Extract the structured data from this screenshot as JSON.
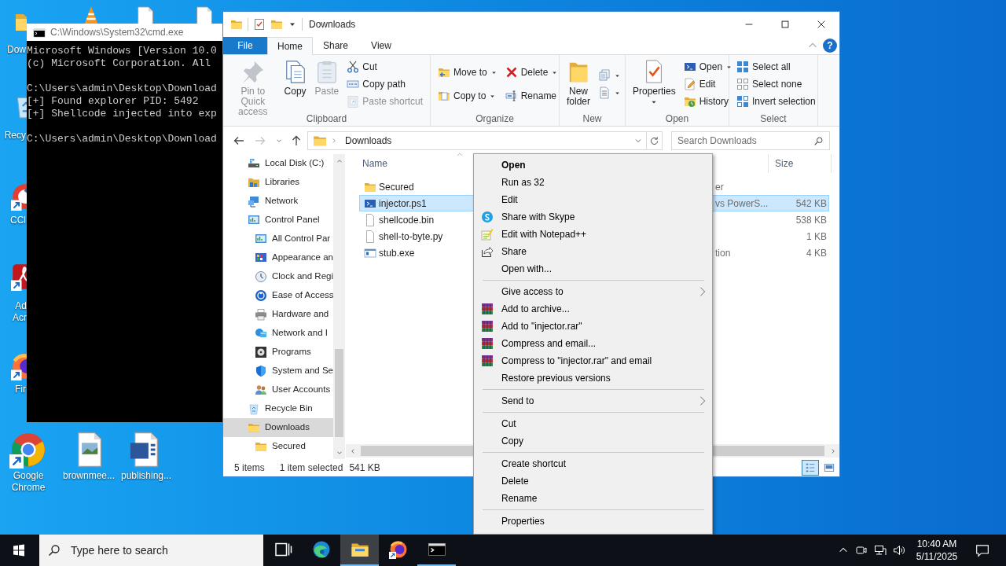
{
  "desktop": {
    "icons": [
      {
        "kind": "folder",
        "label": "Dow"
      },
      {
        "kind": "cone"
      },
      {
        "kind": "document"
      },
      {
        "kind": "document"
      },
      {
        "kind": "recycle",
        "label": "Recy"
      },
      {
        "kind": "cleaner",
        "label": "CCl"
      },
      {
        "kind": "reader",
        "label": "Ad Acr"
      },
      {
        "kind": "firefox",
        "label": "Fir"
      },
      {
        "kind": "chrome",
        "label": "Google Chrome"
      },
      {
        "kind": "image",
        "label": "brownmee..."
      },
      {
        "kind": "word",
        "label": "publishing..."
      }
    ]
  },
  "console": {
    "title": "C:\\Windows\\System32\\cmd.exe",
    "blocks": [
      [
        "Microsoft Windows [Version 10.0",
        "(c) Microsoft Corporation. All"
      ],
      [
        "C:\\Users\\admin\\Desktop\\Download",
        "[+] Found explorer PID: 5492",
        "[+] Shellcode injected into exp"
      ],
      [
        "C:\\Users\\admin\\Desktop\\Download"
      ]
    ]
  },
  "explorer": {
    "title": "Downloads",
    "tabs": [
      {
        "label": "File",
        "kind": "file",
        "selected": false
      },
      {
        "label": "Home",
        "kind": "tab",
        "selected": true
      },
      {
        "label": "Share",
        "kind": "tab",
        "selected": false
      },
      {
        "label": "View",
        "kind": "tab",
        "selected": false
      }
    ],
    "help": "?",
    "ribbon": {
      "groups": [
        {
          "label": "Clipboard",
          "large": [
            {
              "kind": "pin",
              "label": "Pin to Quick access",
              "disabled": true,
              "dropdown": false
            },
            {
              "kind": "copy",
              "label": "Copy",
              "disabled": false,
              "dropdown": false
            },
            {
              "kind": "paste",
              "label": "Paste",
              "disabled": true,
              "dropdown": false
            }
          ],
          "small_columns": [
            [
              {
                "kind": "cut",
                "label": "Cut",
                "disabled": false,
                "dropdown": false
              },
              {
                "kind": "copy-path",
                "label": "Copy path",
                "disabled": false,
                "dropdown": false
              },
              {
                "kind": "paste-shortcut",
                "label": "Paste shortcut",
                "disabled": true,
                "dropdown": false
              }
            ]
          ]
        },
        {
          "label": "Organize",
          "small_columns": [
            [
              {
                "kind": "move-to",
                "label": "Move to",
                "disabled": false,
                "dropdown": true
              },
              {
                "kind": "copy-to",
                "label": "Copy to",
                "disabled": false,
                "dropdown": true
              }
            ],
            [
              {
                "kind": "delete",
                "label": "Delete",
                "disabled": false,
                "dropdown": true
              },
              {
                "kind": "rename",
                "label": "Rename",
                "disabled": false,
                "dropdown": false
              }
            ]
          ]
        },
        {
          "label": "New",
          "large": [
            {
              "kind": "new-folder",
              "label": "New folder",
              "disabled": false,
              "dropdown": false
            }
          ],
          "small_columns": [
            [
              {
                "kind": "new-item",
                "disabled": false,
                "dropdown": true
              },
              {
                "kind": "easy-access",
                "disabled": false,
                "dropdown": true
              }
            ]
          ]
        },
        {
          "label": "Open",
          "large": [
            {
              "kind": "properties",
              "label": "Properties",
              "disabled": false,
              "dropdown": true
            }
          ],
          "small_columns": [
            [
              {
                "kind": "open",
                "label": "Open",
                "disabled": false,
                "dropdown": true
              },
              {
                "kind": "edit",
                "label": "Edit",
                "disabled": false,
                "dropdown": false
              },
              {
                "kind": "history",
                "label": "History",
                "disabled": false,
                "dropdown": false
              }
            ]
          ]
        },
        {
          "label": "Select",
          "small_columns": [
            [
              {
                "kind": "select-all",
                "label": "Select all",
                "disabled": false,
                "dropdown": false
              },
              {
                "kind": "select-none",
                "label": "Select none",
                "disabled": false,
                "dropdown": false
              },
              {
                "kind": "invert",
                "label": "Invert selection",
                "disabled": false,
                "dropdown": false
              }
            ]
          ]
        }
      ]
    },
    "nav_buttons": [
      {
        "kind": "back",
        "disabled": false
      },
      {
        "kind": "forward",
        "disabled": true
      },
      {
        "kind": "recent",
        "disabled": false
      },
      {
        "kind": "up",
        "disabled": false
      }
    ],
    "address": "Downloads",
    "search_placeholder": "Search Downloads",
    "nav": [
      {
        "kind": "drive",
        "label": "Local Disk (C:)",
        "selected": false
      },
      {
        "kind": "library",
        "label": "Libraries",
        "selected": false
      },
      {
        "kind": "network",
        "label": "Network",
        "selected": false
      },
      {
        "kind": "control-panel",
        "label": "Control Panel",
        "selected": false,
        "children": [
          {
            "kind": "control-panel",
            "label": "All Control Par",
            "selected": false
          },
          {
            "kind": "appearance",
            "label": "Appearance an",
            "selected": false
          },
          {
            "kind": "clock",
            "label": "Clock and Regi",
            "selected": false
          },
          {
            "kind": "ease",
            "label": "Ease of Access",
            "selected": false
          },
          {
            "kind": "hardware",
            "label": "Hardware and",
            "selected": false
          },
          {
            "kind": "network-internet",
            "label": "Network and I",
            "selected": false
          },
          {
            "kind": "programs",
            "label": "Programs",
            "selected": false
          },
          {
            "kind": "system",
            "label": "System and Se",
            "selected": false
          },
          {
            "kind": "users",
            "label": "User Accounts",
            "selected": false
          }
        ]
      },
      {
        "kind": "recycle",
        "label": "Recycle Bin",
        "selected": false
      },
      {
        "kind": "folder",
        "label": "Downloads",
        "selected": true,
        "children": [
          {
            "kind": "folder",
            "label": "Secured",
            "selected": false
          }
        ]
      }
    ],
    "columns": {
      "name": "Name",
      "size": "Size"
    },
    "files": [
      {
        "kind": "folder",
        "name": "Secured",
        "column_3": "er",
        "selected": false
      },
      {
        "kind": "script",
        "name": "injector.ps1",
        "column_3": "vs PowerS...",
        "size": "542 KB",
        "selected": true
      },
      {
        "kind": "file",
        "name": "shellcode.bin",
        "size": "538 KB",
        "selected": false
      },
      {
        "kind": "file",
        "name": "shell-to-byte.py",
        "size": "1 KB",
        "selected": false
      },
      {
        "kind": "program",
        "name": "stub.exe",
        "column_3": "tion",
        "size": "4 KB",
        "selected": false
      }
    ],
    "status": {
      "count": "5 items",
      "selection": "1 item selected",
      "selection_size": "541 KB"
    },
    "views": [
      {
        "kind": "details",
        "selected": true
      },
      {
        "kind": "large-icons",
        "selected": false
      }
    ]
  },
  "context_menu": {
    "items": [
      {
        "kind": "plain",
        "label": "Open",
        "default": true
      },
      {
        "kind": "plain",
        "label": "Run as 32",
        "default": false
      },
      {
        "kind": "plain",
        "label": "Edit",
        "default": false
      },
      {
        "kind": "chat",
        "label": "Share with Skype",
        "default": false
      },
      {
        "kind": "notepad",
        "label": "Edit with Notepad++",
        "default": false
      },
      {
        "kind": "share",
        "label": "Share",
        "default": false
      },
      {
        "kind": "plain",
        "label": "Open with...",
        "default": false
      },
      {
        "kind": "separator"
      },
      {
        "kind": "submenu",
        "label": "Give access to",
        "default": false
      },
      {
        "kind": "archive",
        "label": "Add to archive...",
        "default": false
      },
      {
        "kind": "archive",
        "label": "Add to \"injector.rar\"",
        "default": false
      },
      {
        "kind": "archive",
        "label": "Compress and email...",
        "default": false
      },
      {
        "kind": "archive",
        "label": "Compress to \"injector.rar\" and email",
        "default": false
      },
      {
        "kind": "plain",
        "label": "Restore previous versions",
        "default": false
      },
      {
        "kind": "separator"
      },
      {
        "kind": "submenu",
        "label": "Send to",
        "default": false
      },
      {
        "kind": "separator"
      },
      {
        "kind": "plain",
        "label": "Cut",
        "default": false
      },
      {
        "kind": "plain",
        "label": "Copy",
        "default": false
      },
      {
        "kind": "separator"
      },
      {
        "kind": "plain",
        "label": "Create shortcut",
        "default": false
      },
      {
        "kind": "plain",
        "label": "Delete",
        "default": false
      },
      {
        "kind": "plain",
        "label": "Rename",
        "default": false
      },
      {
        "kind": "separator"
      },
      {
        "kind": "plain",
        "label": "Properties",
        "default": false
      }
    ]
  },
  "taskbar": {
    "search_placeholder": "Type here to search",
    "apps": [
      {
        "kind": "task-view",
        "active": false,
        "open": false
      },
      {
        "kind": "edge",
        "active": false,
        "open": false
      },
      {
        "kind": "explorer",
        "active": true,
        "open": true
      },
      {
        "kind": "firefox",
        "active": false,
        "open": false
      },
      {
        "kind": "cmd",
        "active": false,
        "open": true
      }
    ],
    "time": "10:40 AM",
    "date": "5/11/2025"
  }
}
